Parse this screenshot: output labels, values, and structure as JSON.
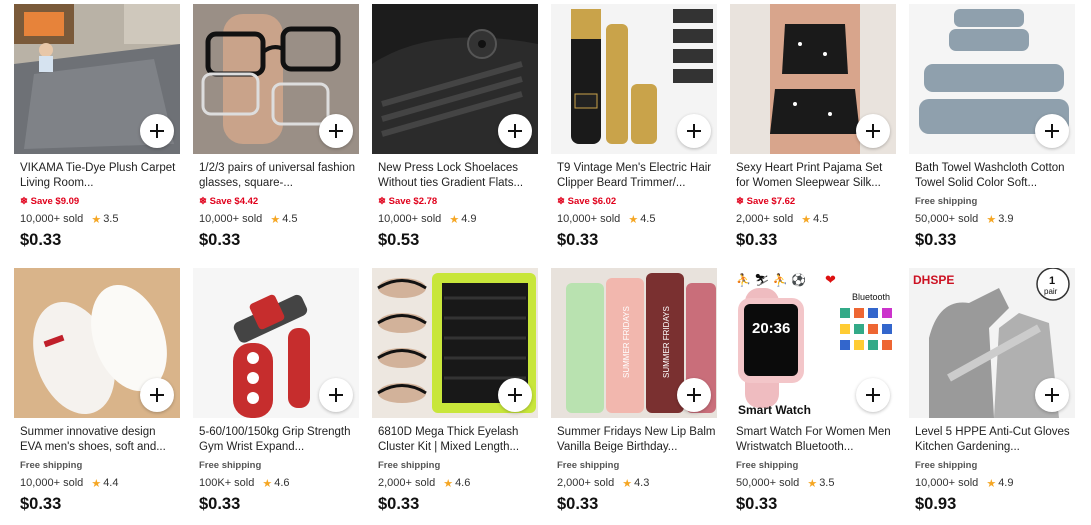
{
  "add_button_icon": "plus-icon",
  "colors": {
    "save": "#e0001b",
    "star": "#f5a623"
  },
  "products": [
    {
      "title": "VIKAMA Tie-Dye Plush Carpet Living Room...",
      "promo": "Save $9.09",
      "promo_type": "save",
      "sold": "10,000+ sold",
      "rating": "3.5",
      "price": "$0.33"
    },
    {
      "title": "1/2/3 pairs of universal fashion glasses, square-...",
      "promo": "Save $4.42",
      "promo_type": "save",
      "sold": "10,000+ sold",
      "rating": "4.5",
      "price": "$0.33"
    },
    {
      "title": "New Press Lock Shoelaces Without ties Gradient Flats...",
      "promo": "Save $2.78",
      "promo_type": "save",
      "sold": "10,000+ sold",
      "rating": "4.9",
      "price": "$0.53"
    },
    {
      "title": "T9 Vintage Men's Electric Hair Clipper Beard Trimmer/...",
      "promo": "Save $6.02",
      "promo_type": "save",
      "sold": "10,000+ sold",
      "rating": "4.5",
      "price": "$0.33"
    },
    {
      "title": "Sexy Heart Print Pajama Set for Women Sleepwear Silk...",
      "promo": "Save $7.62",
      "promo_type": "save",
      "sold": "2,000+ sold",
      "rating": "4.5",
      "price": "$0.33"
    },
    {
      "title": "Bath Towel Washcloth Cotton Towel Solid Color Soft...",
      "promo": "Free shipping",
      "promo_type": "free",
      "sold": "50,000+ sold",
      "rating": "3.9",
      "price": "$0.33"
    },
    {
      "title": "Summer innovative design EVA men's shoes, soft and...",
      "promo": "Free shipping",
      "promo_type": "free",
      "sold": "10,000+ sold",
      "rating": "4.4",
      "price": "$0.33"
    },
    {
      "title": "5-60/100/150kg Grip Strength Gym Wrist Expand...",
      "promo": "Free shipping",
      "promo_type": "free",
      "sold": "100K+ sold",
      "rating": "4.6",
      "price": "$0.33"
    },
    {
      "title": "6810D Mega Thick Eyelash Cluster Kit | Mixed Length...",
      "promo": "Free shipping",
      "promo_type": "free",
      "sold": "2,000+ sold",
      "rating": "4.6",
      "price": "$0.33"
    },
    {
      "title": "Summer Fridays New Lip Balm Vanilla Beige Birthday...",
      "promo": "Free shipping",
      "promo_type": "free",
      "sold": "2,000+ sold",
      "rating": "4.3",
      "price": "$0.33"
    },
    {
      "title": "Smart Watch For Women Men Wristwatch Bluetooth...",
      "promo": "Free shipping",
      "promo_type": "free",
      "sold": "50,000+ sold",
      "rating": "3.5",
      "price": "$0.33"
    },
    {
      "title": "Level 5 HPPE Anti-Cut Gloves Kitchen Gardening...",
      "promo": "Free shipping",
      "promo_type": "free",
      "sold": "10,000+ sold",
      "rating": "4.9",
      "price": "$0.93"
    }
  ],
  "image_text": {
    "watch_label": "Smart Watch",
    "watch_badge": "Bluetooth",
    "watch_time": "20:36",
    "gloves_brand": "DHSPE",
    "gloves_badge_num": "1",
    "gloves_badge_word": "pair",
    "lip_brand": "SUMMER FRIDAYS"
  }
}
